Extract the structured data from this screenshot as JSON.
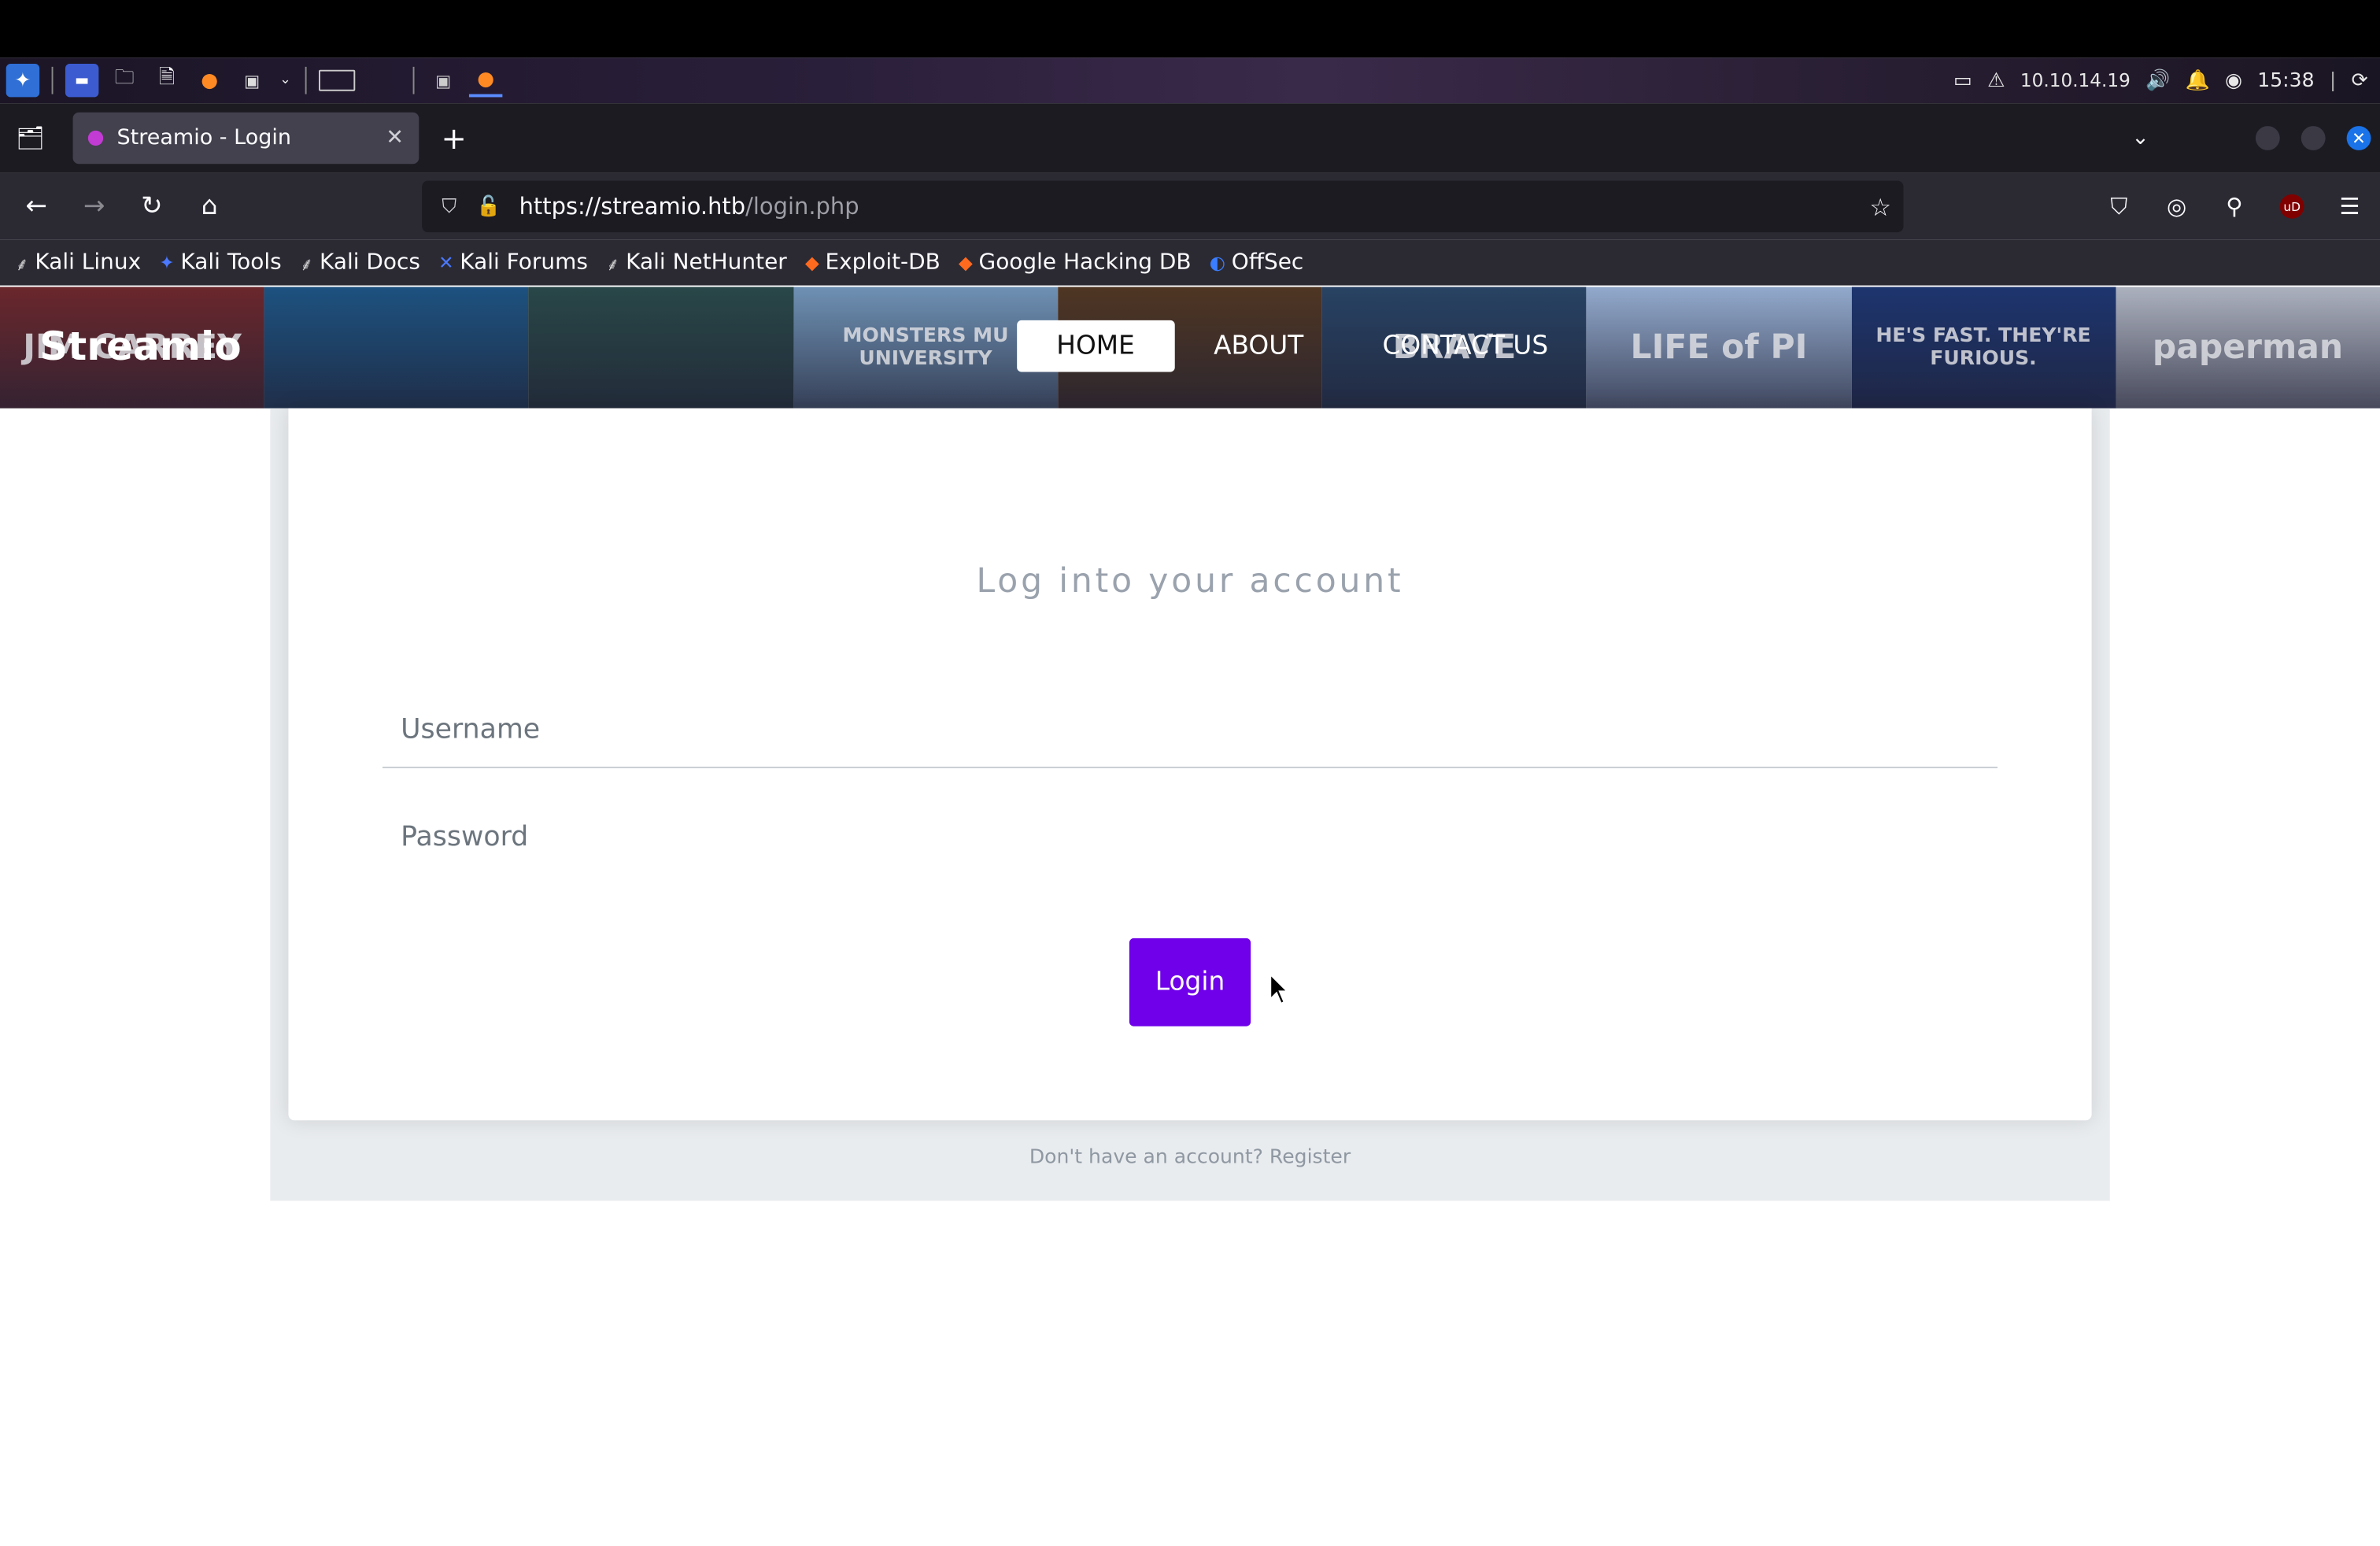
{
  "system_panel": {
    "ip_address": "10.10.14.19",
    "time": "15:38"
  },
  "browser": {
    "tab": {
      "title": "Streamio - Login",
      "favicon_color": "#c23bd3"
    },
    "url": {
      "host": "https://streamio.htb",
      "path": "/login.php"
    },
    "bookmarks": [
      {
        "label": "Kali Linux",
        "icon": "kali-dragon-icon"
      },
      {
        "label": "Kali Tools",
        "icon": "kali-tools-icon"
      },
      {
        "label": "Kali Docs",
        "icon": "kali-dragon-icon"
      },
      {
        "label": "Kali Forums",
        "icon": "kali-forums-icon"
      },
      {
        "label": "Kali NetHunter",
        "icon": "kali-dragon-icon"
      },
      {
        "label": "Exploit-DB",
        "icon": "exploit-db-icon"
      },
      {
        "label": "Google Hacking DB",
        "icon": "exploit-db-icon"
      },
      {
        "label": "OffSec",
        "icon": "offsec-icon"
      }
    ]
  },
  "site": {
    "brand": "Streamio",
    "nav": [
      {
        "label": "HOME",
        "active": true
      },
      {
        "label": "ABOUT",
        "active": false
      },
      {
        "label": "CONTACT US",
        "active": false
      }
    ],
    "posters": [
      {
        "text": "JIM CARREY",
        "color": "#7a2a2a"
      },
      {
        "text": "",
        "color": "#1f5c8c"
      },
      {
        "text": "",
        "color": "#2d4f4a"
      },
      {
        "text": "MONSTERS MU UNIVERSITY",
        "color": "#7fa6c9"
      },
      {
        "text": "",
        "color": "#5a3b1f"
      },
      {
        "text": "BRAVE",
        "color": "#2c4a6b"
      },
      {
        "text": "LIFE of PI",
        "color": "#a9c3e6"
      },
      {
        "text": "HE'S FAST. THEY'RE FURIOUS.",
        "color": "#1f3a78"
      },
      {
        "text": "paperman",
        "color": "#c7ccd6"
      }
    ]
  },
  "login": {
    "title": "Log into your account",
    "username_placeholder": "Username",
    "password_placeholder": "Password",
    "button_label": "Login",
    "button_color": "#6f00e9",
    "footer": "Don't have an account? Register"
  }
}
